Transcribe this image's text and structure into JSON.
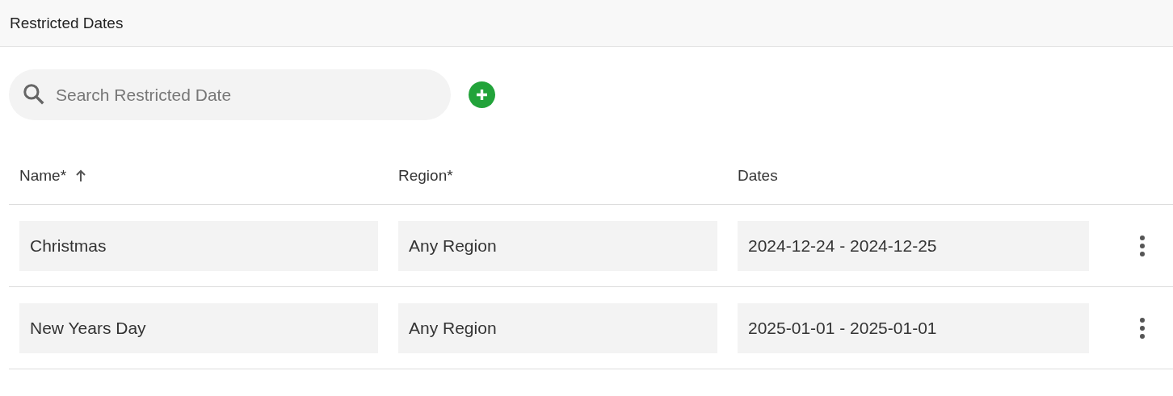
{
  "header": {
    "title": "Restricted Dates"
  },
  "search": {
    "placeholder": "Search Restricted Date"
  },
  "table": {
    "columns": [
      {
        "label": "Name*",
        "sorted": true
      },
      {
        "label": "Region*",
        "sorted": false
      },
      {
        "label": "Dates",
        "sorted": false
      }
    ],
    "rows": [
      {
        "name": "Christmas",
        "region": "Any Region",
        "dates": "2024-12-24 - 2024-12-25"
      },
      {
        "name": "New Years Day",
        "region": "Any Region",
        "dates": "2025-01-01 - 2025-01-01"
      }
    ]
  }
}
